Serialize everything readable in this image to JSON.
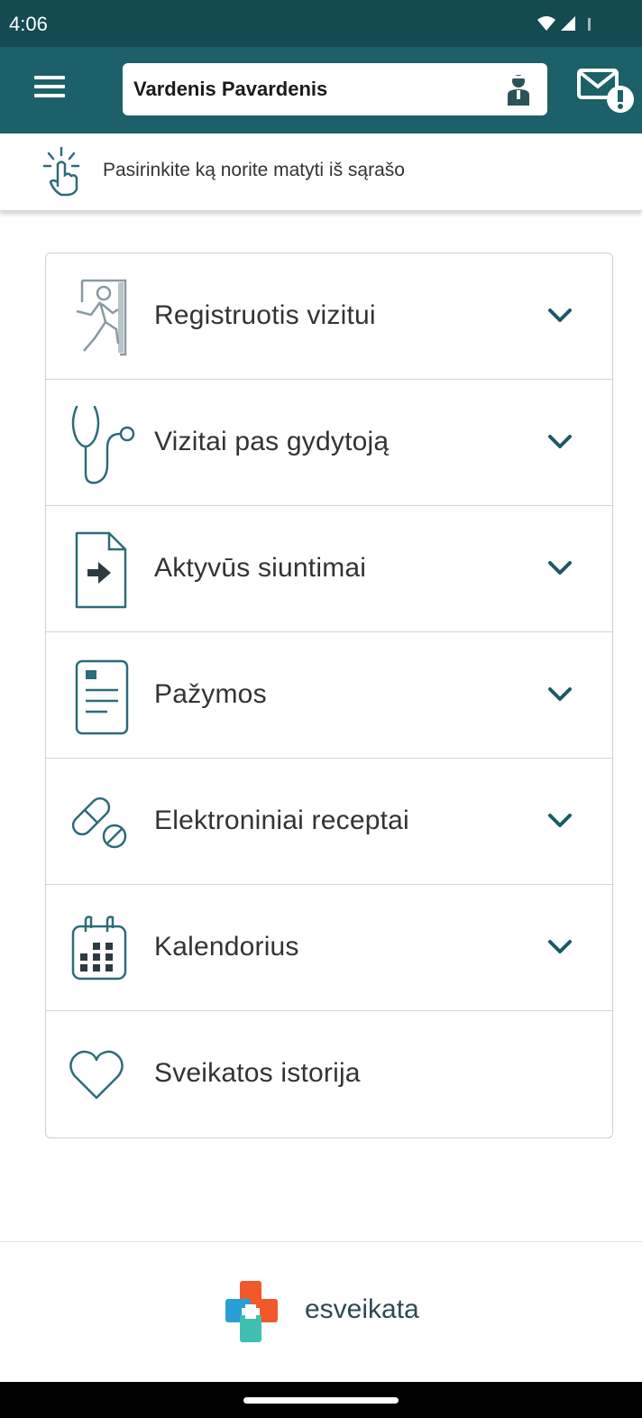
{
  "status_bar": {
    "time": "4:06"
  },
  "header": {
    "user_name": "Vardenis Pavardenis"
  },
  "hint": {
    "text": "Pasirinkite ką norite matyti iš sąrašo"
  },
  "menu": {
    "items": [
      {
        "label": "Registruotis vizitui",
        "icon": "walk-in-door-icon",
        "expandable": true
      },
      {
        "label": "Vizitai pas gydytoją",
        "icon": "stethoscope-icon",
        "expandable": true
      },
      {
        "label": "Aktyvūs siuntimai",
        "icon": "referral-document-icon",
        "expandable": true
      },
      {
        "label": "Pažymos",
        "icon": "certificate-document-icon",
        "expandable": true
      },
      {
        "label": "Elektroniniai receptai",
        "icon": "pills-icon",
        "expandable": true
      },
      {
        "label": "Kalendorius",
        "icon": "calendar-icon",
        "expandable": true
      },
      {
        "label": "Sveikatos istorija",
        "icon": "heart-icon",
        "expandable": false
      }
    ]
  },
  "footer": {
    "brand": "esveikata"
  },
  "colors": {
    "status_bar": "#144b50",
    "app_bar": "#1c6069",
    "icon_stroke": "#2d6c78",
    "chevron": "#1b5a68",
    "logo_orange": "#f05a2a",
    "logo_blue": "#2a9fd6",
    "logo_teal": "#3fbfb0"
  }
}
